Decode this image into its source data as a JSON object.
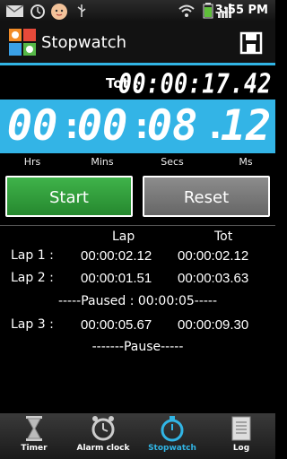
{
  "status_bar": {
    "time": "3:55 PM",
    "icons": [
      "mail-icon",
      "alarm-icon",
      "baby-face-icon",
      "usb-icon",
      "wifi-icon",
      "battery-icon",
      "signal-icon"
    ]
  },
  "app": {
    "title": "Stopwatch",
    "save_icon": "floppy-disk-icon"
  },
  "total": {
    "label": "Tot :",
    "value": "00:00:17.42"
  },
  "timer": {
    "hours": "00",
    "minutes": "00",
    "seconds": "08",
    "centiseconds": "12",
    "units": {
      "hours": "Hrs",
      "minutes": "Mins",
      "seconds": "Secs",
      "centiseconds": "Ms"
    }
  },
  "buttons": {
    "start": "Start",
    "reset": "Reset"
  },
  "laps": {
    "header_lap": "Lap",
    "header_tot": "Tot",
    "rows": [
      {
        "name": "Lap 1 :",
        "lap": "00:00:02.12",
        "tot": "00:00:02.12"
      },
      {
        "name": "Lap 2 :",
        "lap": "00:00:01.51",
        "tot": "00:00:03.63"
      },
      {
        "note": "-----Paused : 00:00:05-----"
      },
      {
        "name": "Lap 3 :",
        "lap": "00:00:05.67",
        "tot": "00:00:09.30"
      },
      {
        "note": "-------Pause-----"
      }
    ]
  },
  "tabs": [
    {
      "label": "Timer",
      "icon": "hourglass-icon",
      "active": false
    },
    {
      "label": "Alarm clock",
      "icon": "alarm-clock-icon",
      "active": false
    },
    {
      "label": "Stopwatch",
      "icon": "stopwatch-icon",
      "active": true
    },
    {
      "label": "Log",
      "icon": "notepad-icon",
      "active": false
    }
  ],
  "colors": {
    "accent": "#33b4e6",
    "start": "#2f9c3a",
    "reset": "#777777"
  }
}
